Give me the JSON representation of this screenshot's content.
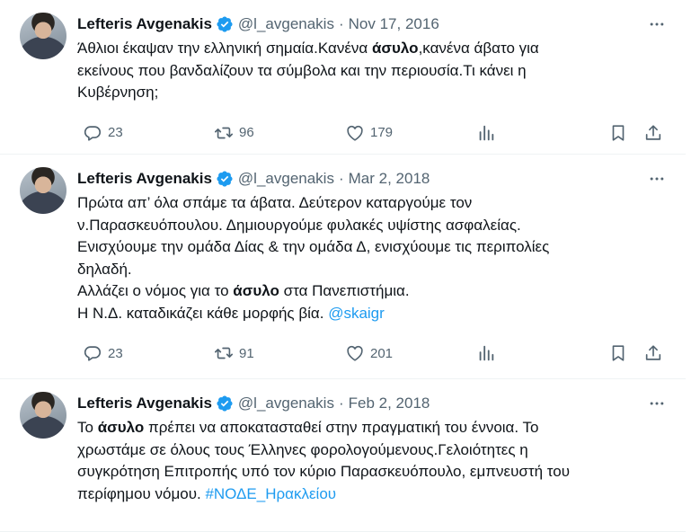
{
  "tweets": [
    {
      "author": "Lefteris Avgenakis",
      "handle": "@l_avgenakis",
      "separator": "·",
      "date": "Nov 17, 2016",
      "lines": [
        [
          {
            "t": "Άθλιοι έκαψαν την ελληνική σημαία.Κανένα "
          },
          {
            "t": "άσυλο",
            "b": true
          },
          {
            "t": ",κανένα άβατο για"
          }
        ],
        [
          {
            "t": "εκείνους που βανδαλίζουν τα σύμβολα και την περιουσία.Τι κάνει η"
          }
        ],
        [
          {
            "t": "Κυβέρνηση;"
          }
        ]
      ],
      "replies": "23",
      "retweets": "96",
      "likes": "179"
    },
    {
      "author": "Lefteris Avgenakis",
      "handle": "@l_avgenakis",
      "separator": "·",
      "date": "Mar 2, 2018",
      "lines": [
        [
          {
            "t": "Πρώτα απ’ όλα σπάμε τα άβατα. Δεύτερον καταργούμε τον"
          }
        ],
        [
          {
            "t": "ν.Παρασκευόπουλου. Δημιουργούμε φυλακές υψίστης ασφαλείας."
          }
        ],
        [
          {
            "t": "Ενισχύουμε την ομάδα Δίας & την ομάδα Δ, ενισχύουμε τις περιπολίες"
          }
        ],
        [
          {
            "t": "δηλαδή."
          }
        ],
        [
          {
            "t": "Αλλάζει ο νόμος για το "
          },
          {
            "t": "άσυλο",
            "b": true
          },
          {
            "t": " στα Πανεπιστήμια."
          }
        ],
        [
          {
            "t": "Η Ν.Δ. καταδικάζει κάθε μορφής βία. "
          },
          {
            "t": "@skaigr",
            "link": true
          }
        ]
      ],
      "replies": "23",
      "retweets": "91",
      "likes": "201"
    },
    {
      "author": "Lefteris Avgenakis",
      "handle": "@l_avgenakis",
      "separator": "·",
      "date": "Feb 2, 2018",
      "lines": [
        [
          {
            "t": "Το "
          },
          {
            "t": "άσυλο",
            "b": true
          },
          {
            "t": " πρέπει να αποκατασταθεί στην πραγματική του έννοια. Το"
          }
        ],
        [
          {
            "t": "χρωστάμε σε όλους τους Έλληνες φορολογούμενους.Γελοιότητες η"
          }
        ],
        [
          {
            "t": "συγκρότηση Επιτροπής υπό τον κύριο Παρασκευόπουλο, εμπνευστή του"
          }
        ],
        [
          {
            "t": "περίφημου νόμου. "
          },
          {
            "t": "#ΝΟΔΕ_Ηρακλείου",
            "link": true
          }
        ]
      ]
    }
  ],
  "icons": {
    "more": "more-horizontal-icon",
    "verified": "verified-badge-icon",
    "reply": "reply-icon",
    "retweet": "retweet-icon",
    "like": "heart-icon",
    "views": "views-chart-icon",
    "bookmark": "bookmark-icon",
    "share": "share-icon"
  },
  "colors": {
    "text": "#0f1419",
    "muted": "#536471",
    "link": "#1d9bf0",
    "verified": "#1d9bf0"
  }
}
